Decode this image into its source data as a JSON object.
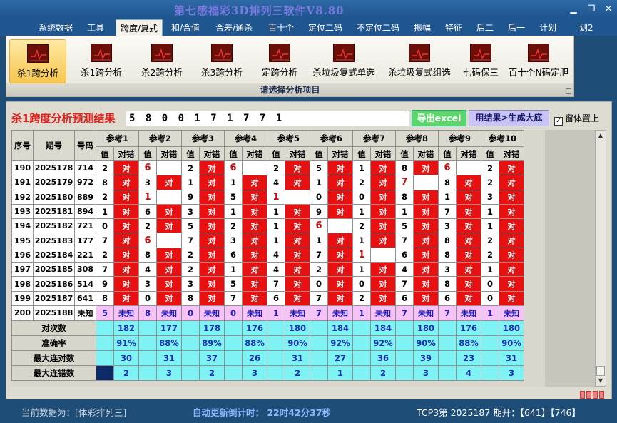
{
  "app": {
    "title": "第七感福彩3D排列三软件V8.80"
  },
  "menu": [
    {
      "label": "系统数据"
    },
    {
      "label": "工具"
    },
    {
      "label": "跨度/复式",
      "active": true
    },
    {
      "label": "和/合值"
    },
    {
      "label": "合差/通杀"
    },
    {
      "label": "百十个"
    },
    {
      "label": "定位二码"
    },
    {
      "label": "不定位二码"
    },
    {
      "label": "振幅"
    },
    {
      "label": "特征"
    },
    {
      "label": "后二"
    },
    {
      "label": "后一"
    },
    {
      "label": "计划"
    },
    {
      "label": "划2"
    }
  ],
  "ribbon": {
    "buttons": [
      {
        "label": "杀1跨分析",
        "active": true
      },
      {
        "label": "杀1跨分析"
      },
      {
        "label": "杀2跨分析"
      },
      {
        "label": "杀3跨分析"
      },
      {
        "label": "定跨分析"
      },
      {
        "label": "杀垃圾复式单选"
      },
      {
        "label": "杀垃圾复式组选"
      },
      {
        "label": "七码保三"
      },
      {
        "label": "百十个N码定胆"
      }
    ],
    "caption": "请选择分析项目"
  },
  "result": {
    "label": "杀1跨度分析预测结果",
    "value": "5 8 0 0 1 7 1 7 7 1",
    "export_label": "导出excel",
    "generate_label": "用结果>生成大底",
    "pin_label": "窗体置上",
    "pin_checked": true
  },
  "grid": {
    "col_seq": "序号",
    "col_period": "期号",
    "col_code": "号码",
    "ref_names": [
      "参考1",
      "参考2",
      "参考3",
      "参考4",
      "参考5",
      "参考6",
      "参考7",
      "参考8",
      "参考9",
      "参考10"
    ],
    "sub_val": "值",
    "sub_right": "对错",
    "hit_text": "对",
    "unknown_text": "未知",
    "rows": [
      {
        "seq": "190",
        "period": "2025178",
        "code": "714",
        "vals": [
          "2",
          "6",
          "2",
          "6",
          "2",
          "5",
          "1",
          "8",
          "6",
          "2"
        ],
        "hits": [
          1,
          0,
          1,
          0,
          1,
          1,
          1,
          1,
          0,
          1
        ]
      },
      {
        "seq": "191",
        "period": "2025179",
        "code": "972",
        "vals": [
          "8",
          "3",
          "1",
          "1",
          "4",
          "1",
          "2",
          "7",
          "8",
          "2"
        ],
        "hits": [
          1,
          1,
          1,
          1,
          1,
          1,
          1,
          0,
          1,
          1
        ]
      },
      {
        "seq": "192",
        "period": "2025180",
        "code": "889",
        "vals": [
          "2",
          "1",
          "9",
          "5",
          "1",
          "0",
          "0",
          "8",
          "1",
          "3"
        ],
        "hits": [
          1,
          0,
          1,
          1,
          0,
          1,
          1,
          1,
          1,
          1
        ]
      },
      {
        "seq": "193",
        "period": "2025181",
        "code": "894",
        "vals": [
          "1",
          "6",
          "3",
          "1",
          "1",
          "9",
          "1",
          "1",
          "7",
          "1"
        ],
        "hits": [
          1,
          1,
          1,
          1,
          1,
          1,
          1,
          1,
          1,
          1
        ]
      },
      {
        "seq": "194",
        "period": "2025182",
        "code": "721",
        "vals": [
          "0",
          "2",
          "5",
          "2",
          "1",
          "6",
          "2",
          "5",
          "3",
          "1"
        ],
        "hits": [
          1,
          1,
          1,
          1,
          1,
          0,
          1,
          1,
          1,
          1
        ]
      },
      {
        "seq": "195",
        "period": "2025183",
        "code": "177",
        "vals": [
          "7",
          "6",
          "7",
          "3",
          "1",
          "1",
          "1",
          "7",
          "8",
          "2"
        ],
        "hits": [
          1,
          0,
          1,
          1,
          1,
          1,
          1,
          1,
          1,
          1
        ]
      },
      {
        "seq": "196",
        "period": "2025184",
        "code": "221",
        "vals": [
          "2",
          "8",
          "2",
          "6",
          "4",
          "7",
          "1",
          "6",
          "8",
          "2"
        ],
        "hits": [
          1,
          1,
          1,
          1,
          1,
          1,
          0,
          1,
          1,
          1
        ]
      },
      {
        "seq": "197",
        "period": "2025185",
        "code": "308",
        "vals": [
          "7",
          "4",
          "2",
          "1",
          "4",
          "2",
          "1",
          "4",
          "3",
          "1"
        ],
        "hits": [
          1,
          1,
          1,
          1,
          1,
          1,
          1,
          1,
          1,
          1
        ]
      },
      {
        "seq": "198",
        "period": "2025186",
        "code": "514",
        "vals": [
          "9",
          "3",
          "3",
          "5",
          "7",
          "0",
          "0",
          "7",
          "8",
          "0"
        ],
        "hits": [
          1,
          1,
          1,
          1,
          1,
          1,
          1,
          1,
          1,
          1
        ]
      },
      {
        "seq": "199",
        "period": "2025187",
        "code": "641",
        "vals": [
          "8",
          "0",
          "8",
          "7",
          "6",
          "7",
          "2",
          "6",
          "6",
          "0"
        ],
        "hits": [
          1,
          1,
          1,
          1,
          1,
          1,
          1,
          1,
          1,
          1
        ]
      }
    ],
    "unknown_row": {
      "seq": "200",
      "period": "2025188",
      "code": "未知",
      "vals": [
        "5",
        "8",
        "0",
        "0",
        "1",
        "7",
        "1",
        "7",
        "7",
        "1"
      ]
    },
    "stats": [
      {
        "label": "对次数",
        "values": [
          "182",
          "177",
          "178",
          "176",
          "180",
          "184",
          "184",
          "180",
          "176",
          "180"
        ]
      },
      {
        "label": "准确率",
        "values": [
          "91%",
          "88%",
          "89%",
          "88%",
          "90%",
          "92%",
          "92%",
          "90%",
          "88%",
          "90%"
        ]
      },
      {
        "label": "最大连对数",
        "values": [
          "30",
          "31",
          "37",
          "26",
          "31",
          "27",
          "36",
          "39",
          "23",
          "31"
        ]
      },
      {
        "label": "最大连错数",
        "values": [
          "2",
          "3",
          "2",
          "3",
          "2",
          "1",
          "2",
          "3",
          "4",
          "3"
        ]
      }
    ]
  },
  "status": {
    "current_data": "当前数据为：[体彩排列三]",
    "countdown": "自动更新倒计时： 22时42分37秒",
    "last_draw": "TCP3第 2025187 期开：【641】【746】"
  }
}
